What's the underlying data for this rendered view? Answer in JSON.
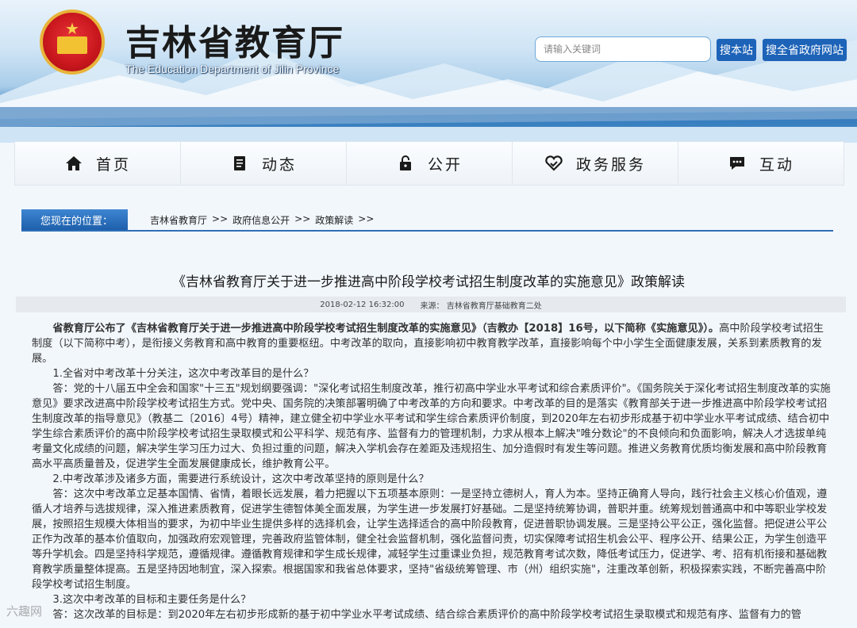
{
  "header": {
    "site_title": "吉林省教育厅",
    "site_title_en": "The Education Department of Jilin Province",
    "search_placeholder": "请输入关键词",
    "search_site_label": "搜本站",
    "search_all_label": "搜全省政府网站"
  },
  "nav": {
    "items": [
      {
        "label": "首页",
        "icon": "home-icon"
      },
      {
        "label": "动态",
        "icon": "document-icon"
      },
      {
        "label": "公开",
        "icon": "lock-icon"
      },
      {
        "label": "政务服务",
        "icon": "handshake-heart-icon"
      },
      {
        "label": "互动",
        "icon": "chat-icon"
      }
    ]
  },
  "location": {
    "label": "您现在的位置：",
    "crumbs": [
      "吉林省教育厅",
      "政府信息公开",
      "政策解读"
    ],
    "separator": ">>"
  },
  "article": {
    "title": "《吉林省教育厅关于进一步推进高中阶段学校考试招生制度改革的实施意见》政策解读",
    "date": "2018-02-12 16:32:00",
    "source": "来源：  吉林省教育厅基础教育二处",
    "lead_bold": "省教育厅公布了《吉林省教育厅关于进一步推进高中阶段学校考试招生制度改革的实施意见》（吉教办【2018】16号，以下简称《实施意见》）。",
    "lead_rest": "高中阶段学校考试招生制度（以下简称中考），是衔接义务教育和高中教育的重要枢纽。中考改革的取向，直接影响初中教育教学改革，直接影响每个中小学生全面健康发展，关系到素质教育的发展。",
    "q1": "1.全省对中考改革十分关注，这次中考改革目的是什么？",
    "a1": "答：党的十八届五中全会和国家\"十三五\"规划纲要强调：\"深化考试招生制度改革，推行初高中学业水平考试和综合素质评价\"。《国务院关于深化考试招生制度改革的实施意见》要求改进高中阶段学校考试招生方式。党中央、国务院的决策部署明确了中考改革的方向和要求。中考改革的目的是落实《教育部关于进一步推进高中阶段学校考试招生制度改革的指导意见》（教基二〔2016〕4号）精神，建立健全初中学业水平考试和学生综合素质评价制度，到2020年左右初步形成基于初中学业水平考试成绩、结合初中学生综合素质评价的高中阶段学校考试招生录取模式和公平科学、规范有序、监督有力的管理机制，力求从根本上解决\"唯分数论\"的不良倾向和负面影响，解决人才选拔单纯考量文化成绩的问题，解决学生学习压力过大、负担过重的问题，解决入学机会存在差距及违规招生、加分造假时有发生等问题。推进义务教育优质均衡发展和高中阶段教育高水平高质量普及，促进学生全面发展健康成长，维护教育公平。",
    "q2": "2.中考改革涉及诸多方面，需要进行系统设计，这次中考改革坚持的原则是什么？",
    "a2": "答：这次中考改革立足基本国情、省情，着眼长远发展，着力把握以下五项基本原则：一是坚持立德树人，育人为本。坚持正确育人导向，践行社会主义核心价值观，遵循人才培养与选拔规律，深入推进素质教育，促进学生德智体美全面发展，为学生进一步发展打好基础。二是坚持统筹协调，普职并重。统筹规划普通高中和中等职业学校发展，按照招生规模大体相当的要求，为初中毕业生提供多样的选择机会，让学生选择适合的高中阶段教育，促进普职协调发展。三是坚持公平公正，强化监督。把促进公平公正作为改革的基本价值取向，加强政府宏观管理，完善政府监管体制，健全社会监督机制，强化监督问责，切实保障考试招生机会公平、程序公开、结果公正，为学生创造平等升学机会。四是坚持科学规范，遵循规律。遵循教育规律和学生成长规律，减轻学生过重课业负担，规范教育考试次数，降低考试压力，促进学、考、招有机衔接和基础教育教学质量整体提高。五是坚持因地制宜，深入探索。根据国家和我省总体要求，坚持\"省级统筹管理、市（州）组织实施\"，注重改革创新，积极探索实践，不断完善高中阶段学校考试招生制度。",
    "q3": "3.这次中考改革的目标和主要任务是什么？",
    "a3": "答：这次改革的目标是：到2020年左右初步形成新的基于初中学业水平考试成绩、结合综合素质评价的高中阶段学校考试招生录取模式和规范有序、监督有力的管"
  },
  "watermark": "六趣网"
}
